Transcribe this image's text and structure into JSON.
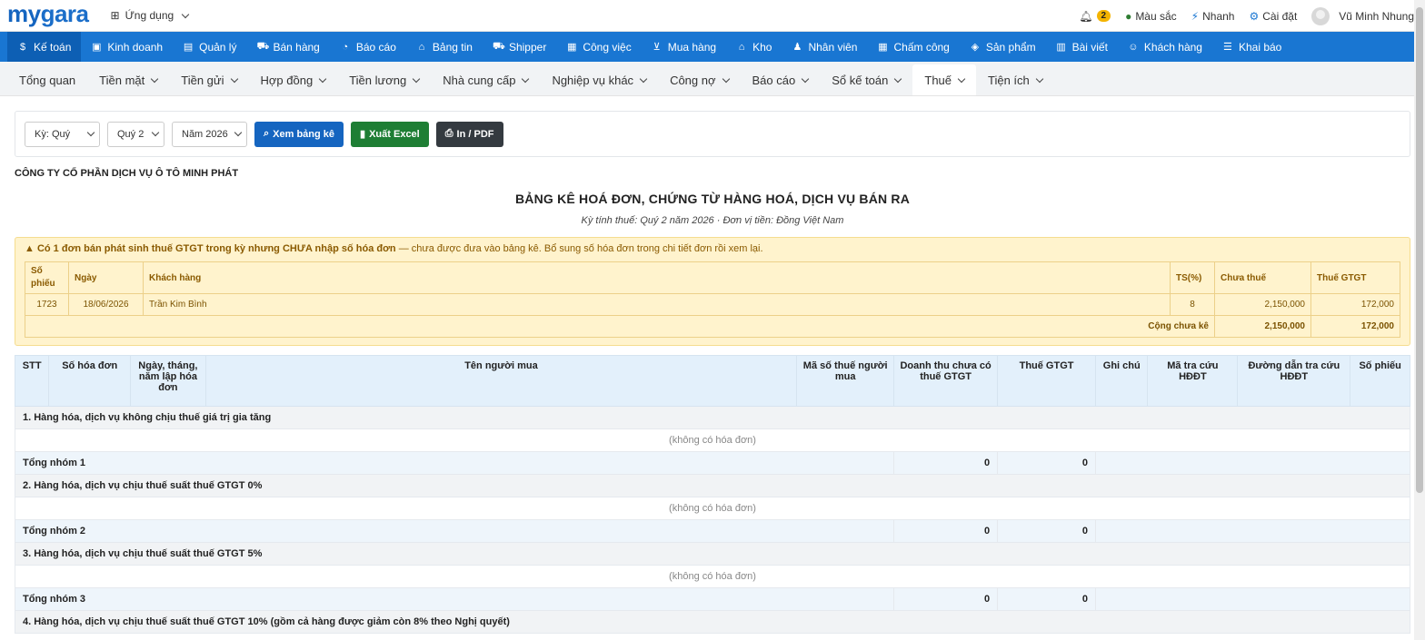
{
  "header": {
    "logo_my": "my",
    "logo_gara": "gara",
    "apps_label": "Ứng dụng",
    "notif_count": "2",
    "color_label": "Màu sắc",
    "quick_label": "Nhanh",
    "settings_label": "Cài đặt",
    "user_name": "Vũ Minh Nhung"
  },
  "mainnav": [
    {
      "label": "Kế toán",
      "icon": "$"
    },
    {
      "label": "Kinh doanh",
      "icon": "▣"
    },
    {
      "label": "Quản lý",
      "icon": "▤"
    },
    {
      "label": "Bán hàng",
      "icon": "⛟"
    },
    {
      "label": "Báo cáo",
      "icon": "◔"
    },
    {
      "label": "Bảng tin",
      "icon": "⌂"
    },
    {
      "label": "Shipper",
      "icon": "⛟"
    },
    {
      "label": "Công việc",
      "icon": "▦"
    },
    {
      "label": "Mua hàng",
      "icon": "⊻"
    },
    {
      "label": "Kho",
      "icon": "⌂"
    },
    {
      "label": "Nhân viên",
      "icon": "♟"
    },
    {
      "label": "Chấm công",
      "icon": "▦"
    },
    {
      "label": "Sản phẩm",
      "icon": "◈"
    },
    {
      "label": "Bài viết",
      "icon": "▥"
    },
    {
      "label": "Khách hàng",
      "icon": "☺"
    },
    {
      "label": "Khai báo",
      "icon": "☰"
    }
  ],
  "subnav": [
    {
      "label": "Tổng quan",
      "dd": false
    },
    {
      "label": "Tiền mặt",
      "dd": true
    },
    {
      "label": "Tiền gửi",
      "dd": true
    },
    {
      "label": "Hợp đồng",
      "dd": true
    },
    {
      "label": "Tiền lương",
      "dd": true
    },
    {
      "label": "Nhà cung cấp",
      "dd": true
    },
    {
      "label": "Nghiệp vụ khác",
      "dd": true
    },
    {
      "label": "Công nợ",
      "dd": true
    },
    {
      "label": "Báo cáo",
      "dd": true
    },
    {
      "label": "Sổ kế toán",
      "dd": true
    },
    {
      "label": "Thuế",
      "dd": true
    },
    {
      "label": "Tiện ích",
      "dd": true
    }
  ],
  "filters": {
    "period_type": "Kỳ: Quý",
    "quarter": "Quý 2",
    "year": "Năm 2026",
    "view_btn": "Xem bảng kê",
    "excel_btn": "Xuất Excel",
    "print_btn": "In / PDF"
  },
  "report": {
    "company": "CÔNG TY CỔ PHẦN DỊCH VỤ Ô TÔ MINH PHÁT",
    "title": "BẢNG KÊ HOÁ ĐƠN, CHỨNG TỪ HÀNG HOÁ, DỊCH VỤ BÁN RA",
    "subtitle": "Kỳ tính thuế: Quý 2 năm 2026  ·  Đơn vị tiền: Đồng Việt Nam"
  },
  "warning": {
    "bold": "Có 1 đơn bán phát sinh thuế GTGT trong kỳ nhưng CHƯA nhập số hóa đơn",
    "rest": " — chưa được đưa vào bảng kê. Bổ sung số hóa đơn trong chi tiết đơn rồi xem lại.",
    "headers": [
      "Số phiếu",
      "Ngày",
      "Khách hàng",
      "TS(%)",
      "Chưa thuế",
      "Thuế GTGT"
    ],
    "row": [
      "1723",
      "18/06/2026",
      "Trần Kim Bình",
      "8",
      "2,150,000",
      "172,000"
    ],
    "total_label": "Cộng chưa kê",
    "total_pre": "2,150,000",
    "total_tax": "172,000"
  },
  "table": {
    "headers": [
      "STT",
      "Số hóa đơn",
      "Ngày, tháng, năm lập hóa đơn",
      "Tên người mua",
      "Mã số thuế người mua",
      "Doanh thu chưa có thuế GTGT",
      "Thuế GTGT",
      "Ghi chú",
      "Mã tra cứu HĐĐT",
      "Đường dẫn tra cứu HĐĐT",
      "Số phiếu"
    ],
    "empty_text": "(không có hóa đơn)",
    "groups": [
      {
        "title": "1. Hàng hóa, dịch vụ không chịu thuế giá trị gia tăng",
        "total_label": "Tổng nhóm 1",
        "rev": "0",
        "tax": "0"
      },
      {
        "title": "2. Hàng hóa, dịch vụ chịu thuế suất thuế GTGT 0%",
        "total_label": "Tổng nhóm 2",
        "rev": "0",
        "tax": "0"
      },
      {
        "title": "3. Hàng hóa, dịch vụ chịu thuế suất thuế GTGT 5%",
        "total_label": "Tổng nhóm 3",
        "rev": "0",
        "tax": "0"
      }
    ],
    "group4_title": "4. Hàng hóa, dịch vụ chịu thuế suất thuế GTGT 10% (gồm cả hàng được giảm còn 8% theo Nghị quyết)"
  }
}
